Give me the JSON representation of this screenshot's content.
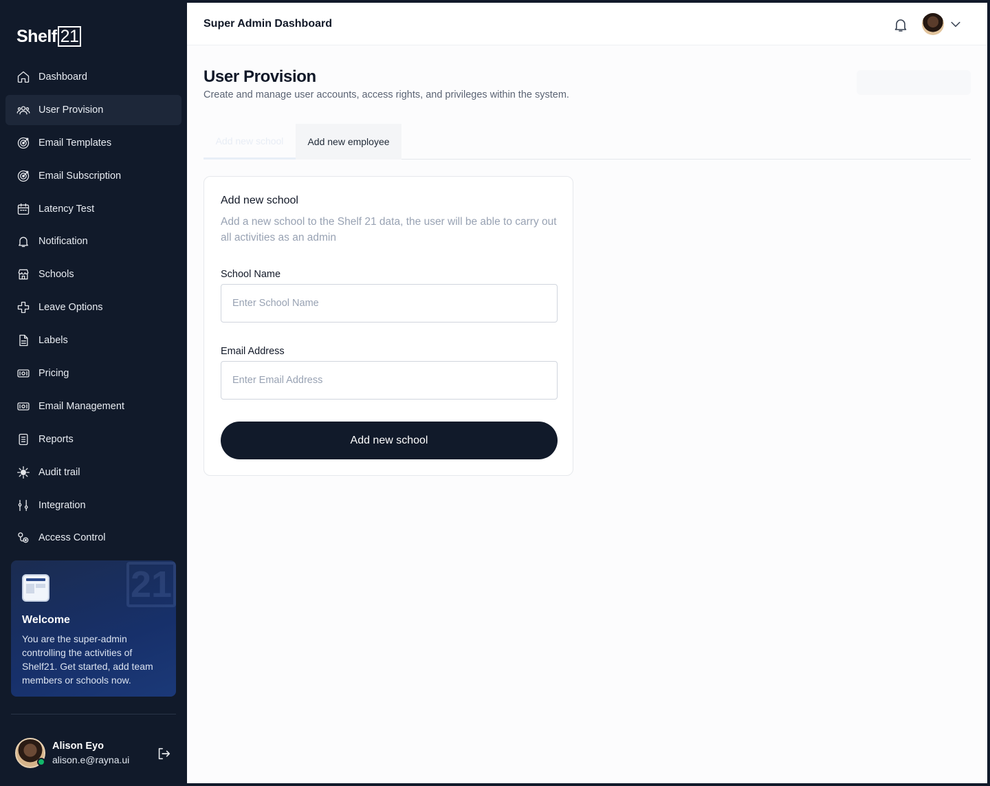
{
  "brand": {
    "name": "Shelf",
    "box": "21"
  },
  "sidebar": {
    "items": [
      {
        "label": "Dashboard",
        "icon": "home-icon"
      },
      {
        "label": "User Provision",
        "icon": "users-icon",
        "active": true
      },
      {
        "label": "Email Templates",
        "icon": "target-icon"
      },
      {
        "label": "Email Subscription",
        "icon": "target-icon"
      },
      {
        "label": "Latency Test",
        "icon": "calendar-icon"
      },
      {
        "label": "Notification",
        "icon": "bell-icon"
      },
      {
        "label": "Schools",
        "icon": "store-icon"
      },
      {
        "label": "Leave Options",
        "icon": "plus-cross-icon"
      },
      {
        "label": "Labels",
        "icon": "document-icon"
      },
      {
        "label": "Pricing",
        "icon": "money-icon"
      },
      {
        "label": "Email Management",
        "icon": "money-icon"
      },
      {
        "label": "Reports",
        "icon": "report-icon"
      },
      {
        "label": "Audit trail",
        "icon": "gear-icon"
      },
      {
        "label": "Integration",
        "icon": "sliders-icon"
      },
      {
        "label": "Access Control",
        "icon": "route-icon"
      }
    ]
  },
  "welcome": {
    "watermark": "21",
    "title": "Welcome",
    "text": "You are the super-admin controlling the activities of Shelf21. Get started, add team members or schools now."
  },
  "user": {
    "name": "Alison Eyo",
    "email": "alison.e@rayna.ui"
  },
  "header": {
    "title": "Super Admin Dashboard"
  },
  "page": {
    "title": "User Provision",
    "subtitle": "Create and manage user accounts, access rights, and privileges within the system."
  },
  "tabs": [
    {
      "label": "Add new school",
      "active": true
    },
    {
      "label": "Add new employee",
      "active": false
    }
  ],
  "form": {
    "title": "Add new school",
    "description": "Add a new school to the Shelf 21 data, the user will be able to carry out all activities as an admin",
    "school_name_label": "School Name",
    "school_name_placeholder": "Enter School Name",
    "email_label": "Email Address",
    "email_placeholder": "Enter Email Address",
    "submit_label": "Add new school"
  },
  "colors": {
    "sidebar_bg": "#111a2a",
    "active_item_bg": "#1d2739",
    "button_bg": "#111a2a",
    "online": "#12b76a"
  }
}
